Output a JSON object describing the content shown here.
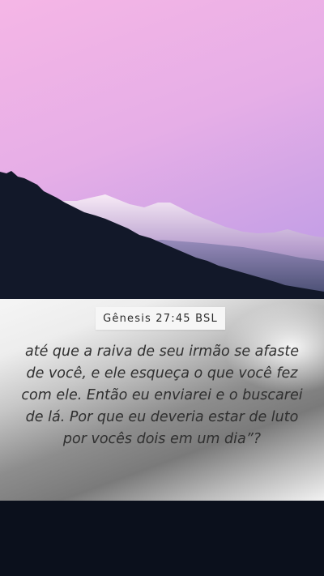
{
  "reference": "Gênesis 27:45 BSL",
  "verse_text": "até que a raiva de seu irmão se afaste de você, e ele esqueça o que você fez com ele. Então eu enviarei e o buscarei de lá. Por que eu deveria estar de luto por vocês dois em um dia”?",
  "colors": {
    "sky_top": "#f5b6e6",
    "sky_bottom": "#b99ce2",
    "forest": "#121829",
    "card_light": "#f5f5f5",
    "card_dark": "#7a7a7a",
    "text": "#2f2f2f",
    "bottom_band": "#0b101c"
  }
}
